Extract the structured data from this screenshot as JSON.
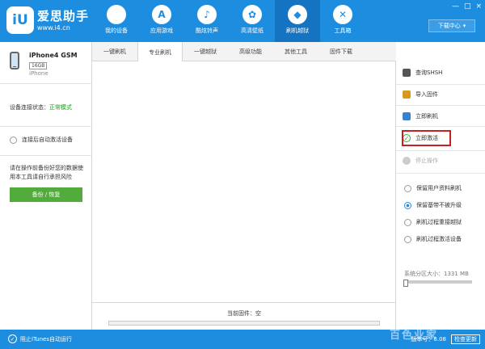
{
  "brand": {
    "logo_text": "iU",
    "name": "爱思助手",
    "url": "www.i4.cn"
  },
  "nav": [
    {
      "label": "我的设备",
      "icon": "apple-icon",
      "glyph": ""
    },
    {
      "label": "应用游戏",
      "icon": "app-store-icon",
      "glyph": "A"
    },
    {
      "label": "酷炫铃声",
      "icon": "bell-icon",
      "glyph": "♪"
    },
    {
      "label": "高清壁纸",
      "icon": "flower-icon",
      "glyph": "✿"
    },
    {
      "label": "刷机越狱",
      "icon": "dropbox-icon",
      "glyph": "◆"
    },
    {
      "label": "工具箱",
      "icon": "tools-icon",
      "glyph": "✕"
    }
  ],
  "window": {
    "download_center": "下载中心",
    "min": "—",
    "max": "□",
    "close": "×"
  },
  "device": {
    "name": "iPhone4 GSM",
    "storage": "16GB",
    "type": "iPhone"
  },
  "status": {
    "label": "设备连接状态：",
    "value": "正常模式"
  },
  "auto_activate": "连接后自动激活设备",
  "warning": "请在操作前备份好您的数据使用本工具请自行承担风险",
  "backup_button": "备份 / 恢复",
  "tabs": [
    {
      "label": "一键刷机",
      "width": 56
    },
    {
      "label": "专业刷机",
      "width": 56
    },
    {
      "label": "一键越狱",
      "width": 56
    },
    {
      "label": "高级功能",
      "width": 56
    },
    {
      "label": "其他工具",
      "width": 56
    },
    {
      "label": "固件下载",
      "width": 56
    }
  ],
  "active_tab": 1,
  "firmware": {
    "label": "当前固件：空",
    "progress": 0
  },
  "actions": [
    {
      "label": "查询SHSH",
      "icon": "search-icon",
      "color": "#555"
    },
    {
      "label": "导入固件",
      "icon": "import-icon",
      "color": "#d69b1a"
    },
    {
      "label": "立即刷机",
      "icon": "flash-icon",
      "color": "#3a80d0"
    },
    {
      "label": "立即激活",
      "icon": "check-circle-icon",
      "color": "#3aa93a"
    },
    {
      "label": "停止操作",
      "icon": "stop-icon",
      "color": "#bbb",
      "disabled": true
    }
  ],
  "options": [
    {
      "label": "保留用户资料刷机",
      "checked": false
    },
    {
      "label": "保留基带不被升级",
      "checked": true
    },
    {
      "label": "刷机过程重接越狱",
      "checked": false
    },
    {
      "label": "刷机过程激活设备",
      "checked": false
    }
  ],
  "partition": {
    "label": "系统分区大小：",
    "value": "1331 MB"
  },
  "statusbar": {
    "itunes": "阻止iTunes自动运行",
    "version": "版本号：6.08",
    "update": "检查更新"
  },
  "watermark": "百色业家",
  "colors": {
    "primary": "#1d8de0",
    "success": "#52ab3b",
    "status_ok": "#1c9a1c",
    "highlight": "#c82020"
  }
}
